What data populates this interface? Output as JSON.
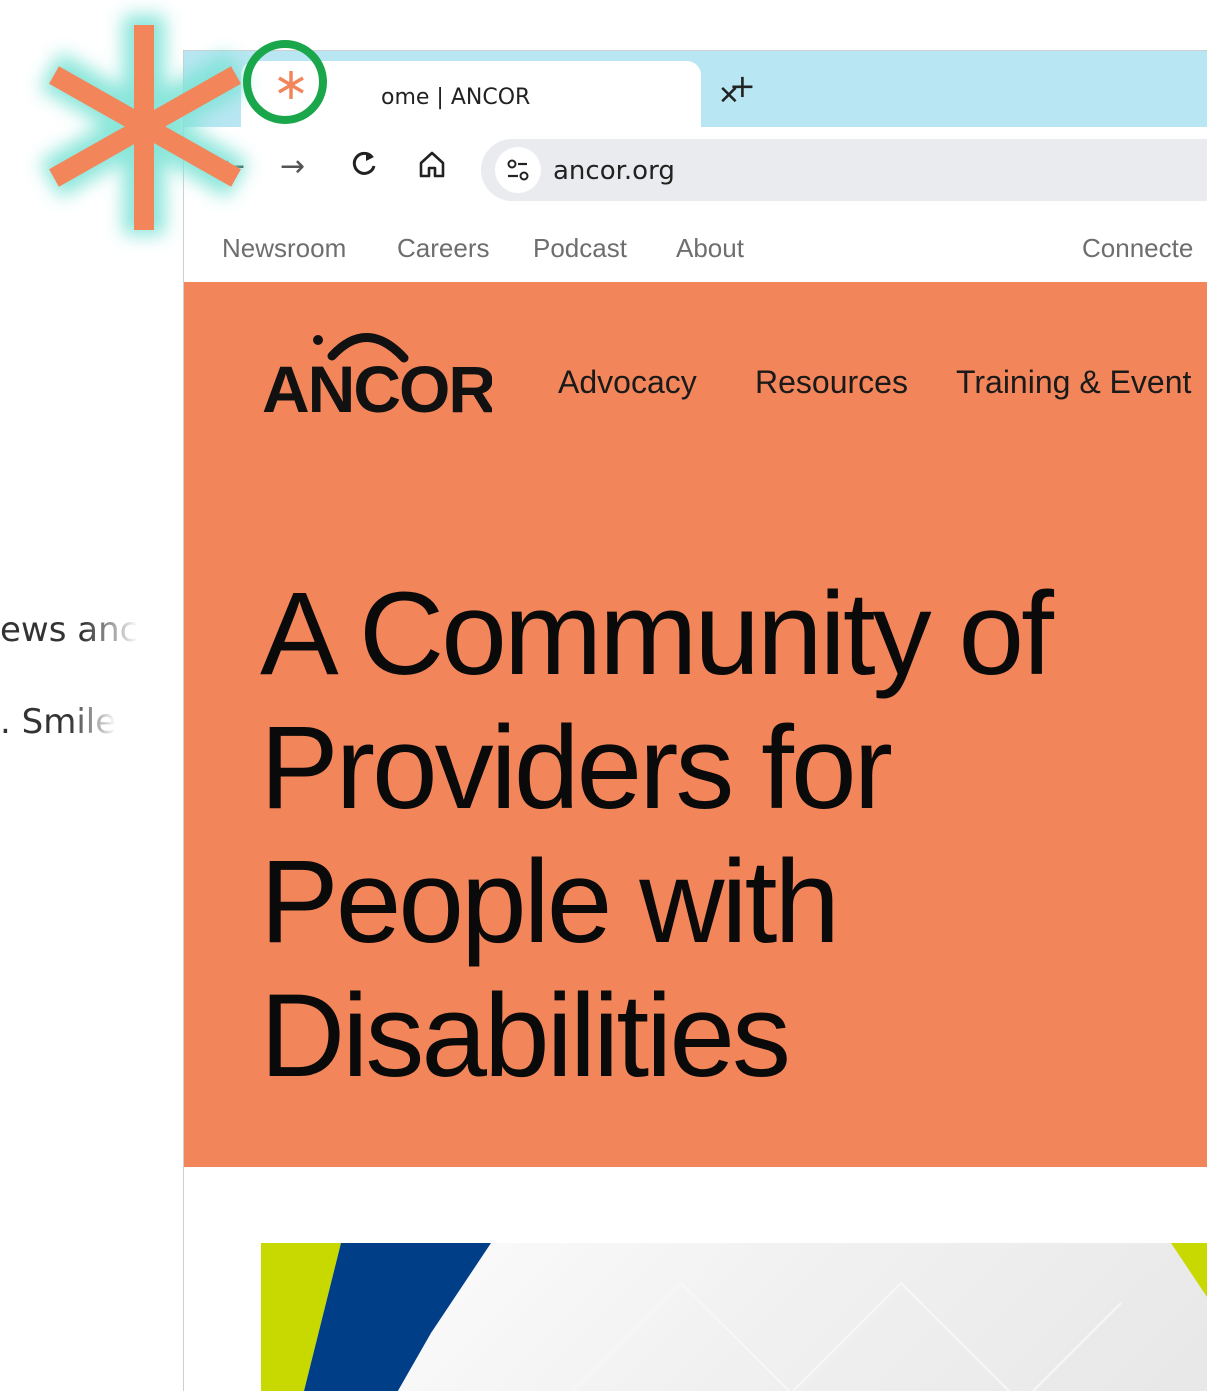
{
  "background_doc": {
    "line1": "ews anc",
    "line2": ". Smile"
  },
  "browser": {
    "tab_title": "ome | ANCOR",
    "tab_close": "✕",
    "new_tab": "+",
    "url": "ancor.org",
    "icons": {
      "back": "arrow-left-icon",
      "forward": "arrow-right-icon",
      "reload": "reload-icon",
      "home": "home-icon",
      "site_info": "tune-icon"
    }
  },
  "site": {
    "top_nav": [
      "Newsroom",
      "Careers",
      "Podcast",
      "About",
      "Connecte"
    ],
    "logo_text": "ANCOR",
    "main_nav": [
      "Advocacy",
      "Resources",
      "Training & Event"
    ],
    "headline_lines": [
      "A Community of",
      "Providers for",
      "People with",
      "Disabilities"
    ],
    "colors": {
      "hero_bg": "#f3855a",
      "tabstrip_bg": "#b8e6f2",
      "annotation_asterisk": "#f3855a",
      "annotation_ring": "#1aa64a",
      "banner_lime": "#c7d900",
      "banner_blue": "#003f87"
    }
  }
}
